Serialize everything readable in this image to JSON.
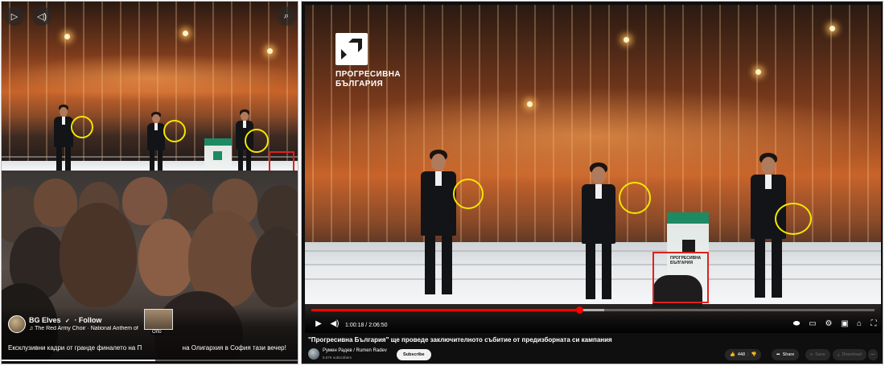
{
  "reel": {
    "user": "BG Elves",
    "verified_glyph": "✓",
    "follow": "· Follow",
    "music": "♫ The Red Army Choir · National Anthem of",
    "caption": "Ексклузивни кадри от гранде финалето на П",
    "caption_tail": "на Олигархия в София тази вечер!",
    "thumb_label": "Orto",
    "progress": 0.52,
    "icons": [
      "play-icon",
      "sound-icon",
      "search-icon"
    ]
  },
  "youtube": {
    "brand_text": "ПРОГРЕСИВНА\nБЪЛГАРИЯ",
    "podium_text": "ПРОГРЕСИВНА\nБЪЛГАРИЯ",
    "time": "1:00:18 / 2:06:50",
    "progress_played": 0.476,
    "progress_loaded": 0.52,
    "title": "\"Прогресивна България\" ще проведе заключителното събитие от предизборната си кампания",
    "channel": "Румен Радев / Rumen Radev",
    "subscribers": "5.67K subscribers",
    "subscribe": "Subscribe",
    "likes": "448",
    "share": "Share",
    "save": "Save",
    "download": "Download",
    "more": "···",
    "accent": "#ff0000"
  }
}
